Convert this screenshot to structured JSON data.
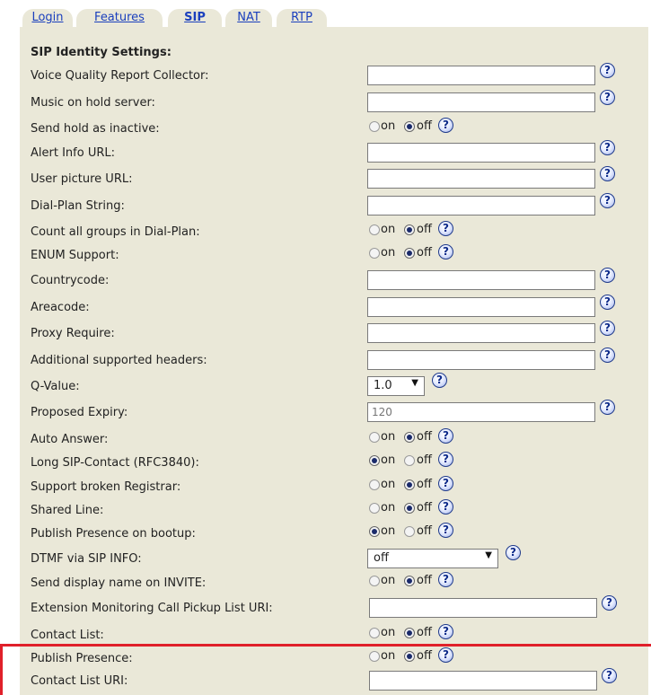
{
  "tabs": [
    {
      "label": "Login",
      "active": false
    },
    {
      "label": "Features",
      "active": false
    },
    {
      "label": "SIP",
      "active": true
    },
    {
      "label": "NAT",
      "active": false
    },
    {
      "label": "RTP",
      "active": false
    }
  ],
  "section_title": "SIP Identity Settings:",
  "help_glyph": "?",
  "radio_labels": {
    "on": "on",
    "off": "off"
  },
  "fields": {
    "voice_quality": {
      "label": "Voice Quality Report Collector:",
      "value": ""
    },
    "music_on_hold": {
      "label": "Music on hold server:",
      "value": ""
    },
    "send_hold_inactive": {
      "label": "Send hold as inactive:",
      "selected": "off"
    },
    "alert_info_url": {
      "label": "Alert Info URL:",
      "value": ""
    },
    "user_picture_url": {
      "label": "User picture URL:",
      "value": ""
    },
    "dial_plan_string": {
      "label": "Dial-Plan String:",
      "value": ""
    },
    "count_all_groups": {
      "label": "Count all groups in Dial-Plan:",
      "selected": "off"
    },
    "enum_support": {
      "label": "ENUM Support:",
      "selected": "off"
    },
    "countrycode": {
      "label": "Countrycode:",
      "value": ""
    },
    "areacode": {
      "label": "Areacode:",
      "value": ""
    },
    "proxy_require": {
      "label": "Proxy Require:",
      "value": ""
    },
    "additional_headers": {
      "label": "Additional supported headers:",
      "value": ""
    },
    "q_value": {
      "label": "Q-Value:",
      "value": "1.0"
    },
    "proposed_expiry": {
      "label": "Proposed Expiry:",
      "value": "",
      "placeholder": "120"
    },
    "auto_answer": {
      "label": "Auto Answer:",
      "selected": "off"
    },
    "long_sip_contact": {
      "label": "Long SIP-Contact (RFC3840):",
      "selected": "on"
    },
    "support_broken_registrar": {
      "label": "Support broken Registrar:",
      "selected": "off"
    },
    "shared_line": {
      "label": "Shared Line:",
      "selected": "off"
    },
    "publish_presence_bootup": {
      "label": "Publish Presence on bootup:",
      "selected": "on"
    },
    "dtmf_sip_info": {
      "label": "DTMF via SIP INFO:",
      "value": "off"
    },
    "send_display_name": {
      "label": "Send display name on INVITE:",
      "selected": "off"
    },
    "ext_monitoring_uri": {
      "label": "Extension Monitoring Call Pickup List URI:",
      "value": ""
    },
    "contact_list": {
      "label": "Contact List:",
      "selected": "off"
    },
    "publish_presence": {
      "label": "Publish Presence:",
      "selected": "off"
    },
    "contact_list_uri": {
      "label": "Contact List URI:",
      "value": ""
    }
  },
  "colors": {
    "panel_bg": "#eae8d8",
    "link": "#1a3fbd",
    "highlight": "#e0202a"
  }
}
